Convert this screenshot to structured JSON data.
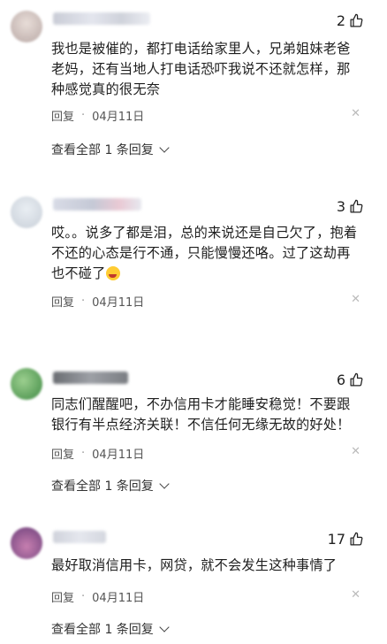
{
  "comments": [
    {
      "likes": "2",
      "text": "我也是被催的，都打电话给家里人，兄弟姐妹老爸老妈，还有当地人打电话恐吓我说不还就怎样，那种感觉真的很无奈",
      "reply_label": "回复",
      "date": "04月11日",
      "view_all": "查看全部 1 条回复"
    },
    {
      "likes": "3",
      "text": "哎。。说多了都是泪，总的来说还是自己欠了，抱着不还的心态是行不通，只能慢慢还咯。过了这劫再也不碰了",
      "reply_label": "回复",
      "date": "04月11日"
    },
    {
      "likes": "6",
      "text": "同志们醒醒吧，不办信用卡才能睡安稳觉！不要跟银行有半点经济关联！不信任何无缘无故的好处！",
      "reply_label": "回复",
      "date": "04月11日",
      "view_all": "查看全部 1 条回复"
    },
    {
      "likes": "17",
      "text": "最好取消信用卡，网贷，就不会发生这种事情了",
      "reply_label": "回复",
      "date": "04月11日",
      "view_all": "查看全部 1 条回复"
    }
  ],
  "icons": {
    "like": "thumbs-up-icon",
    "close": "close-icon",
    "expand": "chevron-down-icon"
  },
  "colors": {
    "text": "#1e1e1e",
    "meta": "#555555",
    "close": "#bbbbbb"
  }
}
